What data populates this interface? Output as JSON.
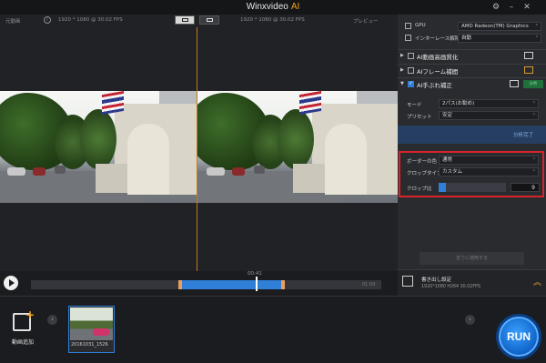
{
  "window": {
    "title": "Winxvideo",
    "title_accent": "AI"
  },
  "preview": {
    "left_label": "元動画",
    "info_text": "i",
    "left_resolution": "1920 * 1080 @ 30.02 FPS",
    "right_resolution": "1920 * 1080 @ 30.02 FPS",
    "right_label": "プレビュー"
  },
  "player": {
    "current_time": "00:41",
    "end_time": "01:00"
  },
  "right_panel": {
    "gpu_label": "GPU",
    "gpu_value": "AMD Radeon(TM) Graphics",
    "deinterlace_label": "インターレース解除",
    "deinterlace_value": "自動",
    "sections": [
      {
        "label": "AI動画高画質化",
        "checked": false
      },
      {
        "label": "AIフレーム補間",
        "checked": false
      },
      {
        "label": "AI手ぶれ補正",
        "checked": true,
        "badge": "分析"
      }
    ],
    "mode_label": "モード",
    "mode_value": "2パス(お勧め)",
    "preset_label": "プリセット",
    "preset_value": "安定",
    "analysis_done": "分析完了",
    "border_label": "ボーダーの色",
    "border_value": "通常",
    "crop_type_label": "クロップタイプ",
    "crop_type_value": "カスタム",
    "crop_ratio_label": "クロップ比",
    "crop_ratio_value": "9",
    "apply_all": "全てに適用する",
    "export_title": "書き出し設定",
    "export_info": "1920*1080  H264  30.02FPS"
  },
  "library": {
    "add_video_label": "動画追加",
    "thumbnail_label": "20161031_1526"
  },
  "run_label": "RUN",
  "colors": {
    "accent_orange": "#f0a21e",
    "blue": "#2f7fd6",
    "highlight_red": "#d8232a"
  }
}
